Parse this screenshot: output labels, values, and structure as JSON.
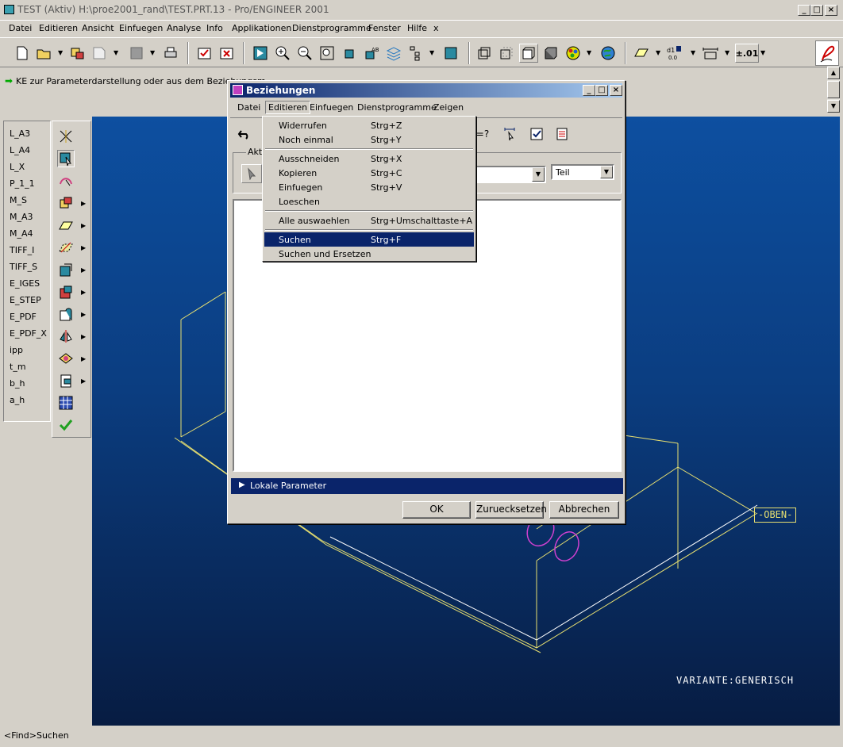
{
  "window": {
    "title": "TEST (Aktiv)  H:\\proe2001_rand\\TEST.PRT.13 - Pro/ENGINEER 2001"
  },
  "menubar": [
    "Datei",
    "Editieren",
    "Ansicht",
    "Einfuegen",
    "Analyse",
    "Info",
    "Applikationen",
    "Dienstprogramme",
    "Fenster",
    "Hilfe",
    "x"
  ],
  "toolbar": {
    "tolerance_label": "±.01"
  },
  "message": "KE zur Parameterdarstellung oder aus dem Beziehungsm",
  "param_list": [
    "L_A3",
    "L_A4",
    "L_X",
    "P_1_1",
    "M_S",
    "M_A3",
    "M_A4",
    "TIFF_I",
    "TIFF_S",
    "E_IGES",
    "E_STEP",
    "E_PDF",
    "E_PDF_X",
    "ipp",
    "t_m",
    "b_h",
    "a_h"
  ],
  "canvas": {
    "view_label": "-OBEN-",
    "variant_label": "VARIANTE:GENERISCH"
  },
  "status": "<Find>Suchen",
  "dialog": {
    "title": "Beziehungen",
    "menu": [
      "Datei",
      "Editieren",
      "Einfuegen",
      "Dienstprogramme",
      "Zeigen"
    ],
    "group_label": "Aktu",
    "type_select": "Teil",
    "lokal_label": "Lokale Parameter",
    "ok": "OK",
    "reset": "Zuruecksetzen",
    "cancel": "Abbrechen"
  },
  "edit_menu": [
    {
      "label": "Widerrufen",
      "shortcut": "Strg+Z"
    },
    {
      "label": "Noch einmal",
      "shortcut": "Strg+Y"
    },
    {
      "label": "Ausschneiden",
      "shortcut": "Strg+X"
    },
    {
      "label": "Kopieren",
      "shortcut": "Strg+C"
    },
    {
      "label": "Einfuegen",
      "shortcut": "Strg+V"
    },
    {
      "label": "Loeschen",
      "shortcut": ""
    },
    {
      "label": "Alle auswaehlen",
      "shortcut": "Strg+Umschalttaste+A"
    },
    {
      "label": "Suchen",
      "shortcut": "Strg+F"
    },
    {
      "label": "Suchen und Ersetzen",
      "shortcut": ""
    }
  ],
  "colors": {
    "title_active": "#0a246a",
    "canvas_top": "#0d4fa0",
    "canvas_bottom": "#071c42",
    "wireframe": "#e8e070",
    "edge_white": "#ffffff",
    "hole": "#d040d0"
  }
}
